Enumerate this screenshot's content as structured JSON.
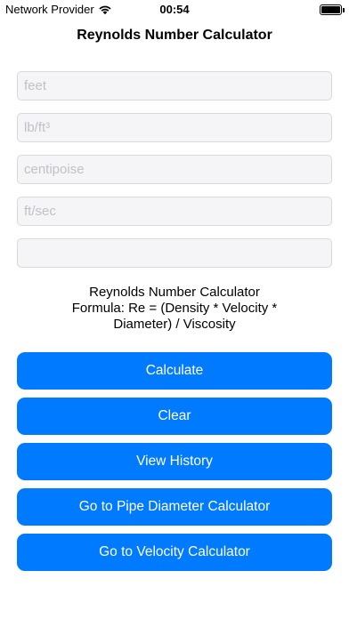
{
  "status": {
    "carrier": "Network Provider",
    "time": "00:54",
    "wifi_icon": "wifi-icon",
    "battery_icon": "battery-icon"
  },
  "header": {
    "title": "Reynolds Number Calculator"
  },
  "inputs": [
    {
      "placeholder": "feet",
      "value": ""
    },
    {
      "placeholder": "lb/ft³",
      "value": ""
    },
    {
      "placeholder": "centipoise",
      "value": ""
    },
    {
      "placeholder": "ft/sec",
      "value": ""
    },
    {
      "placeholder": "",
      "value": ""
    }
  ],
  "info": {
    "line1": "Reynolds Number Calculator",
    "line2": "Formula: Re = (Density * Velocity *",
    "line3": "Diameter) / Viscosity"
  },
  "buttons": {
    "calculate": "Calculate",
    "clear": "Clear",
    "history": "View History",
    "pipe": "Go to Pipe Diameter Calculator",
    "velocity": "Go to Velocity Calculator"
  },
  "colors": {
    "accent": "#007aff",
    "field_bg": "#f5f5f7"
  }
}
